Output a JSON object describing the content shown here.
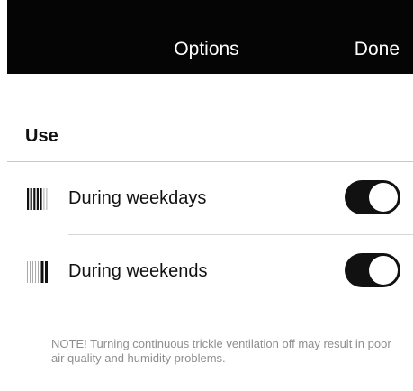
{
  "header": {
    "title": "Options",
    "done_label": "Done"
  },
  "section": {
    "title": "Use"
  },
  "rows": [
    {
      "label": "During weekdays",
      "icon": "weekdays-calendar-icon",
      "enabled": true
    },
    {
      "label": "During weekends",
      "icon": "weekends-calendar-icon",
      "enabled": true
    }
  ],
  "note": "NOTE! Turning continuous trickle ventilation off may result in poor air quality and humidity problems.",
  "colors": {
    "topbar": "#050505",
    "toggle_on": "#111111",
    "note_text": "#8e8e8e"
  }
}
